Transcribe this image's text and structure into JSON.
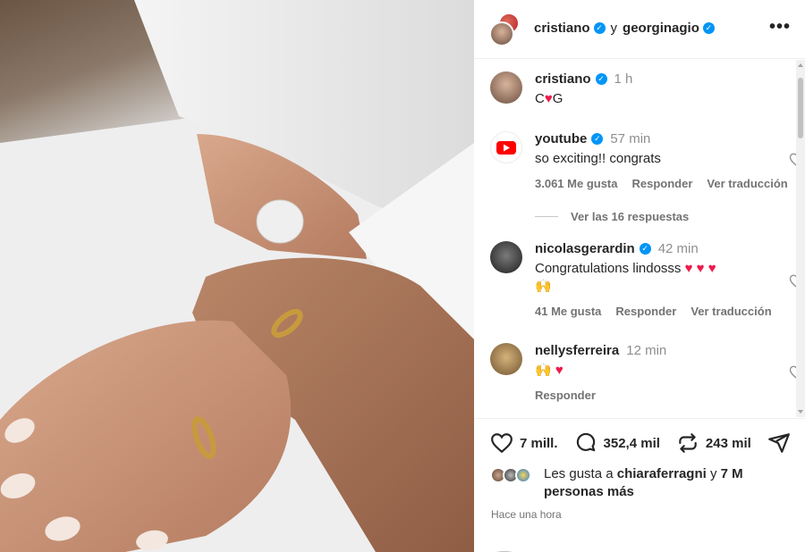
{
  "header": {
    "user1": "cristiano",
    "connector": "y",
    "user2": "georginagio",
    "more": "•••"
  },
  "caption": {
    "user": "cristiano",
    "time": "1 h",
    "text_before": "C",
    "text_after": "G"
  },
  "comments": [
    {
      "user": "youtube",
      "time": "57 min",
      "text": "so exciting!! congrats",
      "likes": "3.061 Me gusta",
      "reply": "Responder",
      "translate": "Ver traducción"
    },
    {
      "user": "nicolasgerardin",
      "time": "42 min",
      "text": "Congratulations lindosss",
      "likes": "41 Me gusta",
      "reply": "Responder",
      "translate": "Ver traducción"
    },
    {
      "user": "nellysferreira",
      "time": "12 min",
      "reply": "Responder"
    }
  ],
  "view_replies": "Ver las 16 respuestas",
  "actions": {
    "likes": "7 mill.",
    "comments": "352,4 mil",
    "reposts": "243 mil"
  },
  "liked_by": {
    "prefix": "Les gusta a",
    "user": "chiaraferragni",
    "connector": "y",
    "rest": "7 M personas más"
  },
  "post_time": "Hace una hora",
  "colors": {
    "verified": "#0095f6",
    "heart": "#ed1a4b",
    "youtube": "#ff0000"
  }
}
